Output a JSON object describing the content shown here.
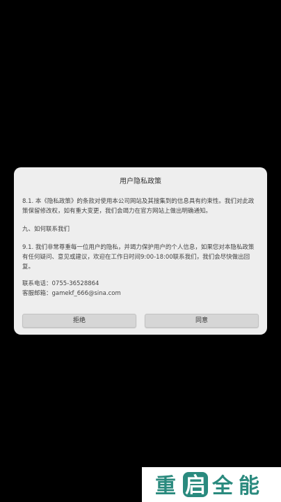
{
  "dialog": {
    "title": "用户隐私政策",
    "paragraph_8_1": "8.1. 本《隐私政策》的条款对使用本公司网站及其搜集到的信息具有约束性。我们对此政策保留修改权，如有重大变更，我们会竭力在官方网站上做出明确通知。",
    "section_9_heading": "九、如何联系我们",
    "paragraph_9_1": "9.1. 我们非常尊重每一位用户的隐私，并竭力保护用户的个人信息，如果您对本隐私政策有任何疑问、意见或建议，欢迎在工作日时间9:00-18:00联系我们，我们会尽快做出回复。",
    "contact_phone": "联系电话：0755-36528864",
    "contact_email": "客服邮箱：gamekf_666@sina.com",
    "reject_label": "拒绝",
    "agree_label": "同意"
  },
  "watermark": {
    "text": "重启全能",
    "icon": "restart-logo-icon",
    "brand_color": "#2a8a7e"
  }
}
